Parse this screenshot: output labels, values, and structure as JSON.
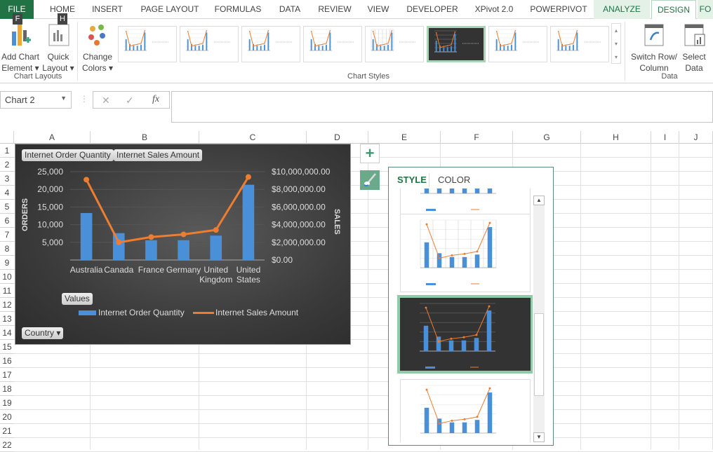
{
  "tabs": [
    {
      "label": "FILE",
      "key": "F"
    },
    {
      "label": "HOME",
      "key": "H"
    },
    {
      "label": "INSERT"
    },
    {
      "label": "PAGE LAYOUT"
    },
    {
      "label": "FORMULAS"
    },
    {
      "label": "DATA"
    },
    {
      "label": "REVIEW"
    },
    {
      "label": "VIEW"
    },
    {
      "label": "DEVELOPER"
    },
    {
      "label": "XPivot 2.0"
    },
    {
      "label": "POWERPIVOT"
    },
    {
      "label": "ANALYZE"
    },
    {
      "label": "DESIGN"
    },
    {
      "label": "FO"
    }
  ],
  "ribbon": {
    "add_chart_element": "Add Chart",
    "add_chart_element2": "Element ▾",
    "quick_layout": "Quick",
    "quick_layout2": "Layout ▾",
    "change_colors": "Change",
    "change_colors2": "Colors ▾",
    "chart_layouts_group": "Chart Layouts",
    "chart_styles_group": "Chart Styles",
    "switch_row": "Switch Row/",
    "switch_row2": "Column",
    "select_data": "Select",
    "select_data2": "Data",
    "data_group": "Data",
    "selected_style_index": 6
  },
  "formula_bar": {
    "name_box": "Chart 2",
    "cancel": "✕",
    "enter": "✓",
    "fx": "fx",
    "value": ""
  },
  "columns": [
    "A",
    "B",
    "C",
    "D",
    "E",
    "F",
    "G",
    "H",
    "I",
    "J"
  ],
  "rows": [
    "1",
    "2",
    "3",
    "4",
    "5",
    "6",
    "7",
    "8",
    "9",
    "10",
    "11",
    "12",
    "13",
    "14",
    "15",
    "16",
    "17",
    "18",
    "19",
    "20",
    "21",
    "22"
  ],
  "chart": {
    "field_buttons": {
      "orders": "Internet Order Quantity",
      "sales": "Internet Sales Amount",
      "values": "Values",
      "country": "Country ▾"
    },
    "legend": [
      "Internet Order Quantity",
      "Internet Sales Amount"
    ],
    "colors": {
      "bar": "#4a90d9",
      "line": "#ed7d31"
    }
  },
  "chart_data": {
    "type": "bar+line",
    "categories": [
      "Australia",
      "Canada",
      "France",
      "Germany",
      "United Kingdom",
      "United States"
    ],
    "category_lines": [
      [
        "Australia"
      ],
      [
        "Canada"
      ],
      [
        "France"
      ],
      [
        "Germany"
      ],
      [
        "United",
        "Kingdom"
      ],
      [
        "United",
        "States"
      ]
    ],
    "series": [
      {
        "name": "Internet Order Quantity",
        "type": "bar",
        "axis": "left",
        "values": [
          13300,
          7600,
          5600,
          5600,
          6900,
          21300
        ]
      },
      {
        "name": "Internet Sales Amount",
        "type": "line",
        "axis": "right",
        "values": [
          9100000,
          2000000,
          2600000,
          2900000,
          3400000,
          9400000
        ]
      }
    ],
    "ylabel": "ORDERS",
    "y2label": "SALES",
    "ylim": [
      0,
      25000
    ],
    "y2lim": [
      0,
      10000000
    ],
    "yticks": [
      "5,000",
      "10,000",
      "15,000",
      "20,000",
      "25,000"
    ],
    "y2ticks": [
      "$0.00",
      "$2,000,000.00",
      "$4,000,000.00",
      "$6,000,000.00",
      "$8,000,000.00",
      "$10,000,000.00"
    ],
    "grid": true,
    "legend_placement": "bottom"
  },
  "style_pane": {
    "tabs": [
      "STYLE",
      "COLOR"
    ],
    "active": "STYLE"
  },
  "icons": {
    "add": "plus-icon",
    "style": "paintbrush-icon"
  }
}
